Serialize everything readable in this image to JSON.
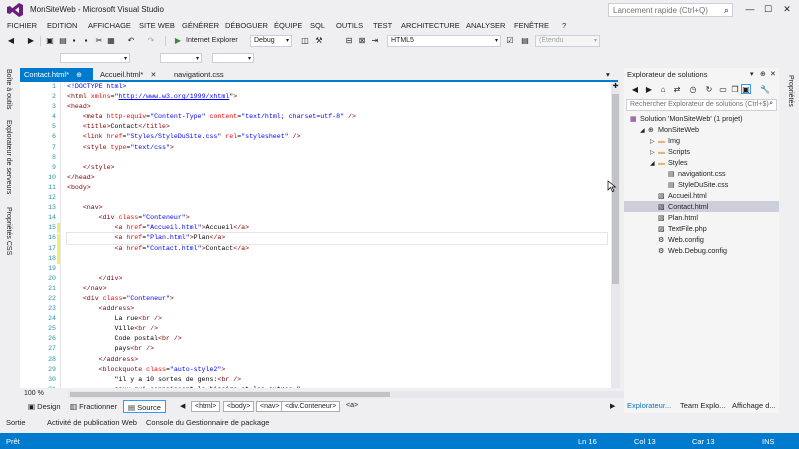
{
  "window": {
    "title": "MonSiteWeb - Microsoft Visual Studio",
    "quick_launch_placeholder": "Lancement rapide (Ctrl+Q)",
    "minimize": "—",
    "maximize": "☐",
    "close": "✕"
  },
  "menu": [
    "FICHIER",
    "EDITION",
    "AFFICHAGE",
    "SITE WEB",
    "GÉNÉRER",
    "DÉBOGUER",
    "ÉQUIPE",
    "SQL",
    "OUTILS",
    "TEST",
    "ARCHITECTURE",
    "ANALYSER",
    "FENÊTRE",
    "?"
  ],
  "toolbar": {
    "browser": "Internet Explorer",
    "config": "Debug",
    "schema": "HTML5",
    "extent": "(Étendu"
  },
  "left_tabs": [
    "Boîte à outils",
    "Explorateur de serveurs",
    "Propriétés CSS"
  ],
  "right_tabs": [
    "Propriétés"
  ],
  "doc_tabs": [
    {
      "label": "Contact.html*",
      "pin": "⊕",
      "close": "✕"
    },
    {
      "label": "Accueil.html*",
      "close": "✕"
    },
    {
      "label": "navigationt.css"
    }
  ],
  "editor": {
    "line_numbers": [
      "1",
      "2",
      "3",
      "4",
      "5",
      "6",
      "7",
      "8",
      "9",
      "10",
      "11",
      "12",
      "13",
      "14",
      "15",
      "16",
      "17",
      "18",
      "19",
      "20",
      "21",
      "22",
      "23",
      "24",
      "25",
      "26",
      "27",
      "28",
      "29",
      "30",
      "31"
    ],
    "code": [
      {
        "i": 0,
        "parts": [
          [
            "dt",
            "<!DOCTYPE html>"
          ]
        ]
      },
      {
        "i": 0,
        "parts": [
          [
            "tg",
            "<html "
          ],
          [
            "at",
            "xmlns"
          ],
          [
            "tx",
            "=\""
          ],
          [
            "ul",
            "http://www.w3.org/1999/xhtml"
          ],
          [
            "tx",
            "\""
          ],
          [
            "tg",
            ">"
          ]
        ]
      },
      {
        "i": 0,
        "parts": [
          [
            "tg",
            "<head>"
          ]
        ]
      },
      {
        "i": 1,
        "parts": [
          [
            "tg",
            "<meta "
          ],
          [
            "at",
            "http-equiv"
          ],
          [
            "tx",
            "="
          ],
          [
            "vl",
            "\"Content-Type\""
          ],
          [
            "tx",
            " "
          ],
          [
            "at",
            "content"
          ],
          [
            "tx",
            "="
          ],
          [
            "vl",
            "\"text/html; charset=utf-8\""
          ],
          [
            "tx",
            " "
          ],
          [
            "tg",
            "/>"
          ]
        ]
      },
      {
        "i": 1,
        "parts": [
          [
            "tg",
            "<title>"
          ],
          [
            "tx",
            "Contact"
          ],
          [
            "tg",
            "</title>"
          ]
        ]
      },
      {
        "i": 1,
        "parts": [
          [
            "tg",
            "<link "
          ],
          [
            "at",
            "href"
          ],
          [
            "tx",
            "="
          ],
          [
            "vl",
            "\"Styles/StyleDuSite.css\""
          ],
          [
            "tx",
            " "
          ],
          [
            "at",
            "rel"
          ],
          [
            "tx",
            "="
          ],
          [
            "vl",
            "\"stylesheet\""
          ],
          [
            "tx",
            " "
          ],
          [
            "tg",
            "/>"
          ]
        ]
      },
      {
        "i": 1,
        "parts": [
          [
            "tg",
            "<style "
          ],
          [
            "at",
            "type"
          ],
          [
            "tx",
            "="
          ],
          [
            "vl",
            "\"text/css\""
          ],
          [
            "tg",
            ">"
          ]
        ]
      },
      {
        "i": 0,
        "parts": []
      },
      {
        "i": 1,
        "parts": [
          [
            "tg",
            "</style>"
          ]
        ]
      },
      {
        "i": 0,
        "parts": [
          [
            "tg",
            "</head>"
          ]
        ]
      },
      {
        "i": 0,
        "parts": [
          [
            "tg",
            "<body>"
          ]
        ]
      },
      {
        "i": 0,
        "parts": []
      },
      {
        "i": 1,
        "parts": [
          [
            "tg",
            "<nav>"
          ]
        ]
      },
      {
        "i": 2,
        "parts": [
          [
            "tg",
            "<div "
          ],
          [
            "at",
            "class"
          ],
          [
            "tx",
            "="
          ],
          [
            "vl",
            "\"Conteneur\""
          ],
          [
            "tg",
            ">"
          ]
        ]
      },
      {
        "i": 3,
        "parts": [
          [
            "tg",
            "<a "
          ],
          [
            "at",
            "href"
          ],
          [
            "tx",
            "="
          ],
          [
            "vl",
            "\"Accueil.html\""
          ],
          [
            "tg",
            ">"
          ],
          [
            "tx",
            "Accueil"
          ],
          [
            "tg",
            "</a>"
          ]
        ]
      },
      {
        "i": 3,
        "parts": [
          [
            "tg",
            "<a "
          ],
          [
            "at",
            "href"
          ],
          [
            "tx",
            "="
          ],
          [
            "vl",
            "\"Plan.html\""
          ],
          [
            "tg",
            ">"
          ],
          [
            "tx",
            "Plan"
          ],
          [
            "tg",
            "</a>"
          ]
        ]
      },
      {
        "i": 3,
        "parts": [
          [
            "tg",
            "<a "
          ],
          [
            "at",
            "href"
          ],
          [
            "tx",
            "="
          ],
          [
            "vl",
            "\"Contact.html\""
          ],
          [
            "tg",
            ">"
          ],
          [
            "tx",
            "Contact"
          ],
          [
            "tg",
            "</a>"
          ]
        ]
      },
      {
        "i": 0,
        "parts": []
      },
      {
        "i": 0,
        "parts": []
      },
      {
        "i": 2,
        "parts": [
          [
            "tg",
            "</div>"
          ]
        ]
      },
      {
        "i": 1,
        "parts": [
          [
            "tg",
            "</nav>"
          ]
        ]
      },
      {
        "i": 1,
        "parts": [
          [
            "tg",
            "<div "
          ],
          [
            "at",
            "class"
          ],
          [
            "tx",
            "="
          ],
          [
            "vl",
            "\"Conteneur\""
          ],
          [
            "tg",
            ">"
          ]
        ]
      },
      {
        "i": 2,
        "parts": [
          [
            "tg",
            "<address>"
          ]
        ]
      },
      {
        "i": 3,
        "parts": [
          [
            "tx",
            "La rue"
          ],
          [
            "tg",
            "<br />"
          ]
        ]
      },
      {
        "i": 3,
        "parts": [
          [
            "tx",
            "Ville"
          ],
          [
            "tg",
            "<br />"
          ]
        ]
      },
      {
        "i": 3,
        "parts": [
          [
            "tx",
            "Code postal"
          ],
          [
            "tg",
            "<br />"
          ]
        ]
      },
      {
        "i": 3,
        "parts": [
          [
            "tx",
            "pays"
          ],
          [
            "tg",
            "<br />"
          ]
        ]
      },
      {
        "i": 2,
        "parts": [
          [
            "tg",
            "</address>"
          ]
        ]
      },
      {
        "i": 2,
        "parts": [
          [
            "tg",
            "<blockquote "
          ],
          [
            "at",
            "class"
          ],
          [
            "tx",
            "="
          ],
          [
            "vl",
            "\"auto-style2\""
          ],
          [
            "tg",
            ">"
          ]
        ]
      },
      {
        "i": 3,
        "parts": [
          [
            "tx",
            "\"il y a 10 sortes de gens:"
          ],
          [
            "tg",
            "<br />"
          ]
        ]
      },
      {
        "i": 3,
        "parts": [
          [
            "tx",
            "ceux qui connaissent le binaire et les autres.\""
          ]
        ]
      }
    ],
    "current_line": 16,
    "modified_lines": [
      15,
      16,
      17,
      18
    ]
  },
  "zoom": "100 %",
  "view_buttons": [
    {
      "label": "Design"
    },
    {
      "label": "Fractionner"
    },
    {
      "label": "Source"
    }
  ],
  "breadcrumbs": [
    "<html>",
    "<body>",
    "<nav>",
    "<div.Conteneur>",
    "<a>"
  ],
  "solution_explorer": {
    "title": "Explorateur de solutions",
    "search_placeholder": "Rechercher Explorateur de solutions (Ctrl+$)",
    "nodes": [
      {
        "label": "Solution 'MonSiteWeb' (1 projet)",
        "level": 0,
        "arrow": "",
        "icon": "solution-icon"
      },
      {
        "label": "MonSiteWeb",
        "level": 0,
        "arrow": "◢",
        "icon": "web-project-icon"
      },
      {
        "label": "Img",
        "level": 1,
        "arrow": "▷",
        "icon": "folder-icon"
      },
      {
        "label": "Scripts",
        "level": 1,
        "arrow": "▷",
        "icon": "folder-icon"
      },
      {
        "label": "Styles",
        "level": 1,
        "arrow": "◢",
        "icon": "folder-icon"
      },
      {
        "label": "navigationt.css",
        "level": 2,
        "arrow": "",
        "icon": "css-file-icon"
      },
      {
        "label": "StyleDuSite.css",
        "level": 2,
        "arrow": "",
        "icon": "css-file-icon"
      },
      {
        "label": "Accueil.html",
        "level": 1,
        "arrow": "",
        "icon": "html-file-icon"
      },
      {
        "label": "Contact.html",
        "level": 1,
        "arrow": "",
        "icon": "html-file-icon"
      },
      {
        "label": "Plan.html",
        "level": 1,
        "arrow": "",
        "icon": "html-file-icon"
      },
      {
        "label": "TextFile.php",
        "level": 1,
        "arrow": "",
        "icon": "php-file-icon"
      },
      {
        "label": "Web.config",
        "level": 1,
        "arrow": "",
        "icon": "config-file-icon"
      },
      {
        "label": "Web.Debug.config",
        "level": 1,
        "arrow": "",
        "icon": "config-file-icon"
      }
    ],
    "selected_node": "Contact.html",
    "tabs": [
      "Explorateur...",
      "Team Explo...",
      "Affichage d..."
    ]
  },
  "output_tabs": [
    "Sortie",
    "Activité de publication Web",
    "Console du Gestionnaire de package"
  ],
  "status": {
    "state": "Prêt",
    "line": "Ln 16",
    "col": "Col 13",
    "char": "Car 13",
    "mode": "INS"
  },
  "colors": {
    "accent": "#007ACC",
    "tag": "#800000",
    "attribute": "#FF0000",
    "value": "#0000FF",
    "line_number": "#2B91AF",
    "change_marker": "#EFEF6B"
  }
}
